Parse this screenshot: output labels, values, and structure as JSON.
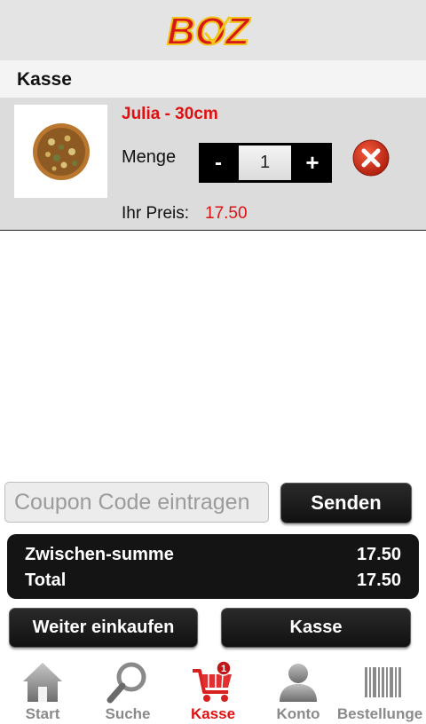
{
  "header": {
    "logo_text": "BOZ"
  },
  "section": {
    "title": "Kasse"
  },
  "cart_item": {
    "name": "Julia - 30cm",
    "quantity_label": "Menge",
    "minus_label": "-",
    "quantity": "1",
    "plus_label": "+",
    "price_label": "Ihr Preis:",
    "price": "17.50",
    "image_icon": "pizza-icon",
    "remove_icon": "remove-icon"
  },
  "coupon": {
    "placeholder": "Coupon Code eintragen",
    "value": "",
    "submit_label": "Senden"
  },
  "totals": {
    "subtotal_label": "Zwischen-summe",
    "subtotal": "17.50",
    "total_label": "Total",
    "total": "17.50"
  },
  "actions": {
    "continue_label": "Weiter einkaufen",
    "checkout_label": "Kasse"
  },
  "tabbar": {
    "tabs": [
      {
        "label": "Start",
        "icon": "home-icon"
      },
      {
        "label": "Suche",
        "icon": "search-icon"
      },
      {
        "label": "Kasse",
        "icon": "cart-icon",
        "badge": "1",
        "active": true
      },
      {
        "label": "Konto",
        "icon": "user-icon"
      },
      {
        "label": "Bestellunge",
        "icon": "barcode-icon"
      }
    ]
  },
  "colors": {
    "accent": "#e01010",
    "header_bg": "#e4e4e4",
    "item_bg": "#dcdcdc",
    "dark": "#141414"
  }
}
